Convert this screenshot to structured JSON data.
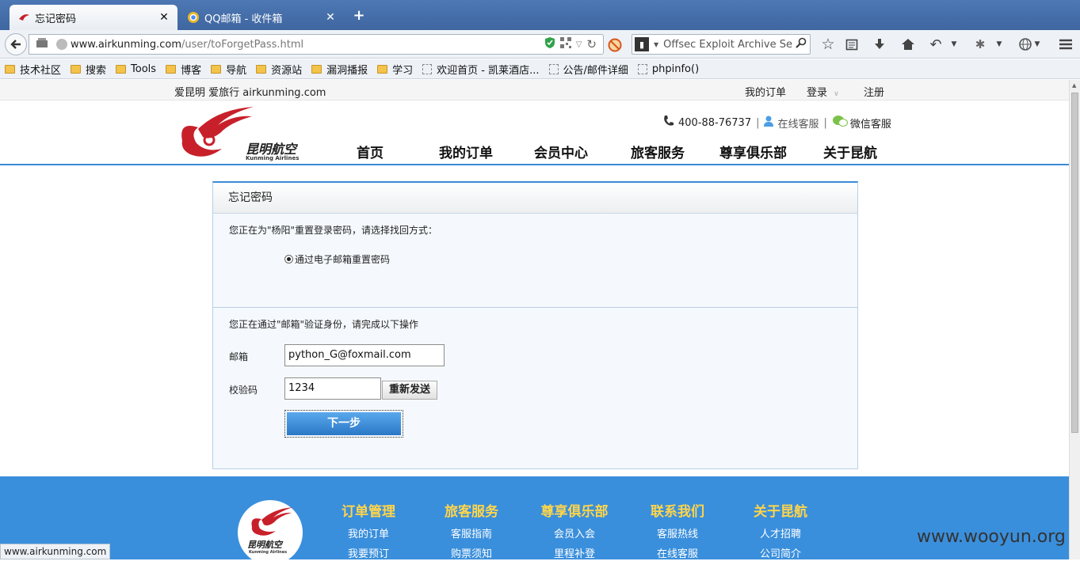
{
  "browser": {
    "tabs": [
      {
        "title": "忘记密码",
        "active": true
      },
      {
        "title": "QQ邮箱 - 收件箱",
        "active": false
      }
    ],
    "url_host": "www.airkunming.com",
    "url_path": "/user/toForgetPass.html",
    "search_placeholder": "Offsec Exploit Archive Search",
    "bookmarks": [
      "技术社区",
      "搜索",
      "Tools",
      "博客",
      "导航",
      "资源站",
      "漏洞播报",
      "学习",
      "欢迎首页 - 凯莱酒店...",
      "公告/邮件详细",
      "phpinfo()"
    ],
    "status_url": "www.airkunming.com"
  },
  "site": {
    "slogan": "爱昆明 爱旅行 airkunming.com",
    "top_links": {
      "orders": "我的订单",
      "login": "登录",
      "register": "注册"
    },
    "logo_cn": "昆明航空",
    "logo_en": "Kunming Airlines",
    "phone": "400-88-76737",
    "online_service": "在线客服",
    "wechat_service": "微信客服",
    "nav": [
      "首页",
      "我的订单",
      "会员中心",
      "旅客服务",
      "尊享俱乐部",
      "关于昆航"
    ]
  },
  "form": {
    "panel_title": "忘记密码",
    "intro": "您正在为\"杨阳\"重置登录密码，请选择找回方式：",
    "method_option": "通过电子邮箱重置密码",
    "verify_text": "您正在通过\"邮箱\"验证身份，请完成以下操作",
    "email_label": "邮箱",
    "email_value": "python_G@foxmail.com",
    "code_label": "校验码",
    "code_value": "1234",
    "resend_label": "重新发送",
    "next_label": "下一步"
  },
  "footer": {
    "columns": [
      {
        "title": "订单管理",
        "items": [
          "我的订单",
          "我要预订"
        ]
      },
      {
        "title": "旅客服务",
        "items": [
          "客服指南",
          "购票须知"
        ]
      },
      {
        "title": "尊享俱乐部",
        "items": [
          "会员入会",
          "里程补登"
        ]
      },
      {
        "title": "联系我们",
        "items": [
          "客服热线",
          "在线客服"
        ]
      },
      {
        "title": "关于昆航",
        "items": [
          "人才招聘",
          "公司简介"
        ]
      }
    ]
  },
  "watermark": "www.wooyun.org",
  "colors": {
    "brand_blue": "#3a8fdc",
    "footer_heading": "#ffd54a",
    "logo_red": "#c8202a"
  }
}
